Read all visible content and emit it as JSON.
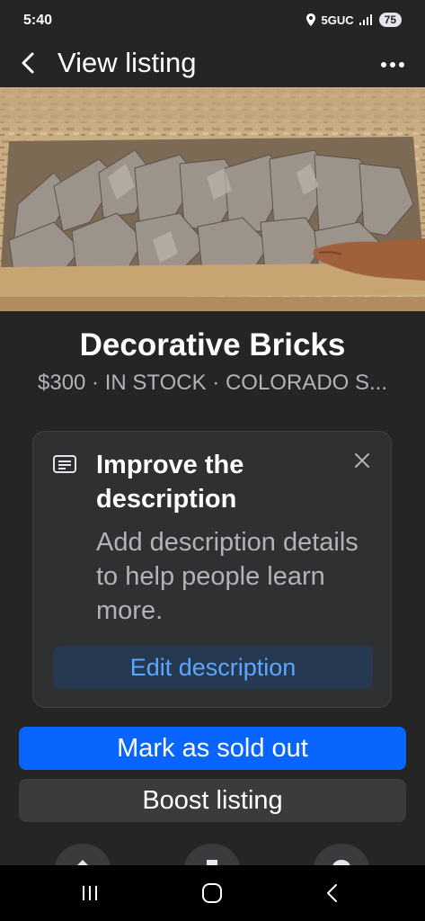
{
  "status_bar": {
    "time": "5:40",
    "network": "5GUC",
    "battery": "75",
    "icons": [
      "location-icon",
      "signal-icon"
    ]
  },
  "header": {
    "title": "View listing",
    "back_icon": "back-chevron-icon",
    "more_icon": "more-options-icon"
  },
  "listing": {
    "title": "Decorative Bricks",
    "subtitle": "$300 · IN STOCK · COLORADO S..."
  },
  "improve_card": {
    "icon": "description-icon",
    "title": "Improve the description",
    "body": "Add description details to help people learn more.",
    "button_label": "Edit description",
    "close_icon": "close-icon"
  },
  "buttons": {
    "primary_label": "Mark as sold out",
    "secondary_label": "Boost listing"
  },
  "nav": {
    "icons": [
      "recent-apps-icon",
      "home-icon",
      "back-icon"
    ]
  },
  "colors": {
    "background": "#252526",
    "accent": "#0866ff",
    "link": "#5aa7ff"
  }
}
